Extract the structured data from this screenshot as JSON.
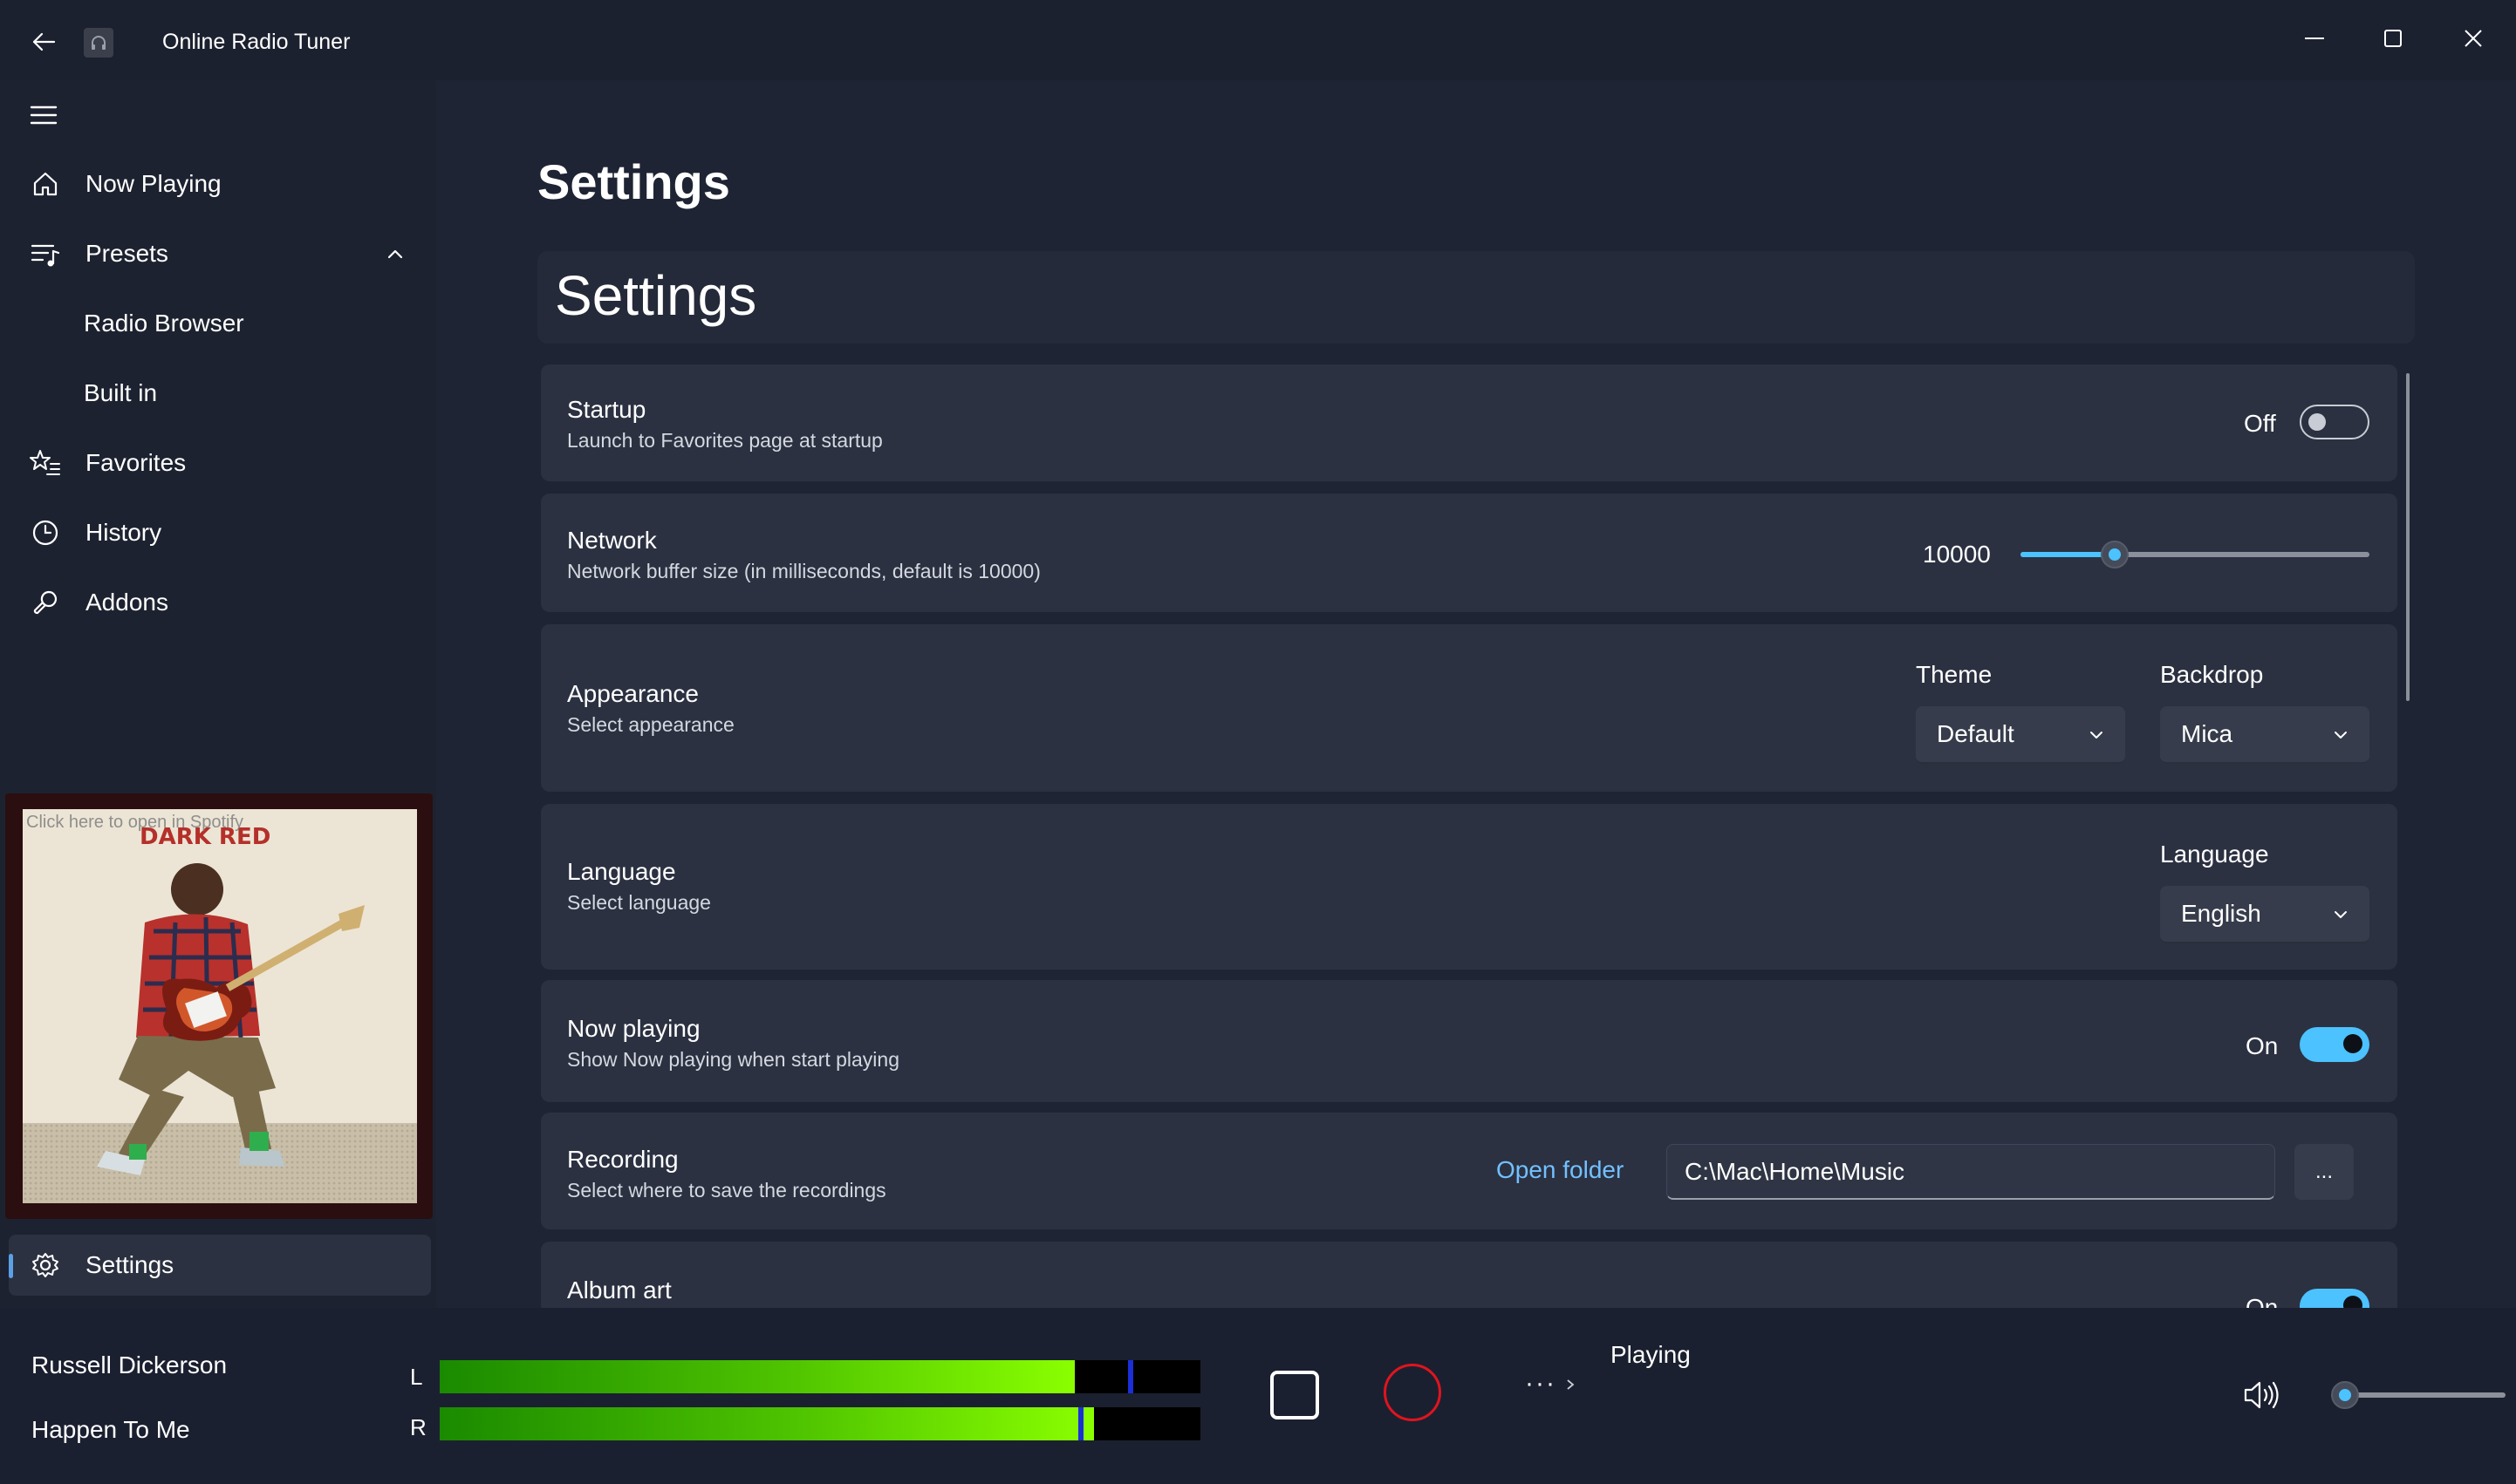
{
  "window": {
    "title": "Online Radio Tuner"
  },
  "nav": {
    "items": [
      {
        "label": "Now Playing",
        "icon": "home-icon"
      },
      {
        "label": "Presets",
        "icon": "playlist-icon"
      },
      {
        "label": "Radio Browser"
      },
      {
        "label": "Built in"
      },
      {
        "label": "Favorites",
        "icon": "star-list-icon"
      },
      {
        "label": "History",
        "icon": "clock-icon"
      },
      {
        "label": "Addons",
        "icon": "wrench-icon"
      }
    ],
    "settings_label": "Settings",
    "album_hint": "Click here to open in Spotify",
    "album_brand": "DARK RED"
  },
  "page": {
    "title": "Settings",
    "header_title": "Settings"
  },
  "settings": {
    "startup": {
      "title": "Startup",
      "desc": "Launch to Favorites page at startup",
      "state": "Off",
      "on": false
    },
    "network": {
      "title": "Network",
      "desc": "Network buffer size (in milliseconds, default is 10000)",
      "value": "10000",
      "slider_fraction": 0.27
    },
    "appearance": {
      "title": "Appearance",
      "desc": "Select appearance",
      "theme_label": "Theme",
      "theme_value": "Default",
      "backdrop_label": "Backdrop",
      "backdrop_value": "Mica"
    },
    "language": {
      "title": "Language",
      "desc": "Select language",
      "label": "Language",
      "value": "English"
    },
    "now_playing": {
      "title": "Now playing",
      "desc": "Show Now playing when start playing",
      "state": "On",
      "on": true
    },
    "recording": {
      "title": "Recording",
      "desc": "Select where to save the recordings",
      "open_folder": "Open folder",
      "path": "C:\\Mac\\Home\\Music",
      "browse": "..."
    },
    "album_art": {
      "title": "Album art",
      "state": "On",
      "on": true
    }
  },
  "player": {
    "artist": "Russell Dickerson",
    "song": "Happen To Me",
    "left_label": "L",
    "right_label": "R",
    "left_level": 0.835,
    "right_level": 0.86,
    "left_peak": 0.905,
    "right_peak": 0.84,
    "more": "···",
    "status": "Playing",
    "volume_fraction": 0.0
  },
  "colors": {
    "accent": "#4cc2ff",
    "record": "#e0141e",
    "meter_green": "#4fc400"
  }
}
